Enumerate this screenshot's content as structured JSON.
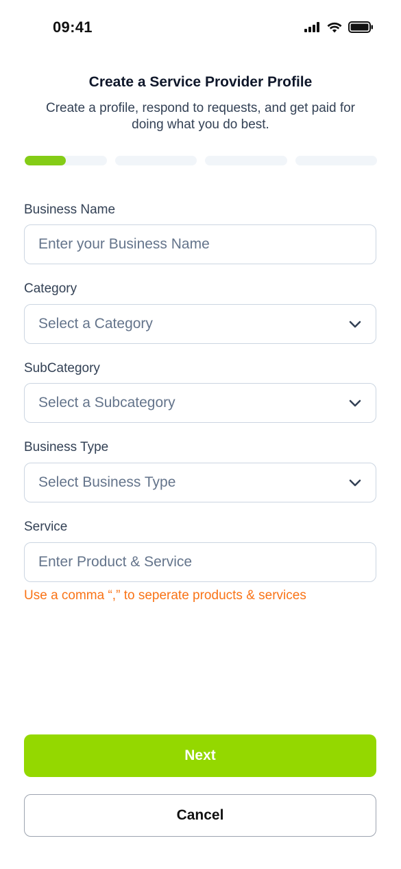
{
  "status_bar": {
    "time": "09:41",
    "icons": [
      "cellular-signal-icon",
      "wifi-icon",
      "battery-icon"
    ]
  },
  "header": {
    "title": "Create a Service Provider Profile",
    "subtitle": "Create a profile, respond to requests, and get paid for doing what you do best."
  },
  "progress": {
    "total_steps": 4,
    "current_step": 1,
    "current_step_fill": 0.5,
    "fill_color": "#84cc16",
    "track_color": "#f1f5f9"
  },
  "form": {
    "business_name": {
      "label": "Business Name",
      "placeholder": "Enter your Business Name",
      "value": ""
    },
    "category": {
      "label": "Category",
      "placeholder": "Select a Category",
      "icon": "chevron-down-icon"
    },
    "subcategory": {
      "label": "SubCategory",
      "placeholder": "Select a Subcategory",
      "icon": "chevron-down-icon"
    },
    "business_type": {
      "label": "Business Type",
      "placeholder": "Select Business Type",
      "icon": "chevron-down-icon"
    },
    "service": {
      "label": "Service",
      "placeholder": "Enter Product & Service",
      "value": "",
      "hint": "Use a comma “,” to seperate products & services"
    }
  },
  "actions": {
    "next_label": "Next",
    "cancel_label": "Cancel",
    "primary_color": "#94d800",
    "hint_color": "#f97316"
  }
}
